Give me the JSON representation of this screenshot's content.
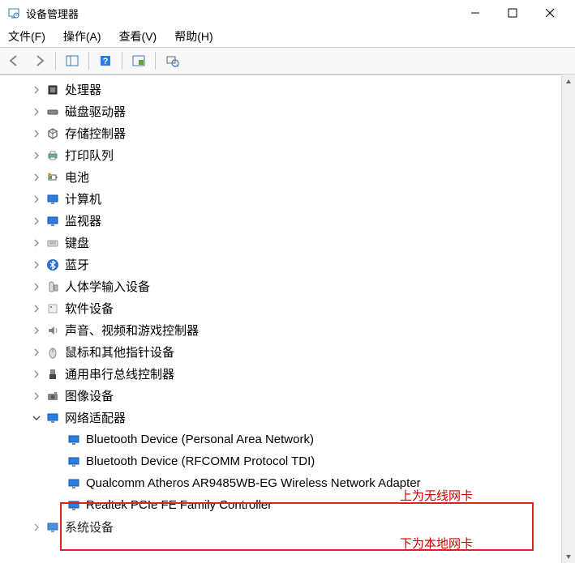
{
  "window": {
    "title": "设备管理器"
  },
  "menu": {
    "file": "文件(F)",
    "action": "操作(A)",
    "view": "查看(V)",
    "help": "帮助(H)"
  },
  "tree": {
    "items": [
      {
        "label": "处理器",
        "icon": "cpu",
        "expanded": false
      },
      {
        "label": "磁盘驱动器",
        "icon": "disk",
        "expanded": false
      },
      {
        "label": "存储控制器",
        "icon": "storage",
        "expanded": false
      },
      {
        "label": "打印队列",
        "icon": "printer",
        "expanded": false
      },
      {
        "label": "电池",
        "icon": "battery",
        "expanded": false
      },
      {
        "label": "计算机",
        "icon": "monitor",
        "expanded": false
      },
      {
        "label": "监视器",
        "icon": "monitor",
        "expanded": false
      },
      {
        "label": "键盘",
        "icon": "keyboard",
        "expanded": false
      },
      {
        "label": "蓝牙",
        "icon": "bluetooth",
        "expanded": false
      },
      {
        "label": "人体学输入设备",
        "icon": "hid",
        "expanded": false
      },
      {
        "label": "软件设备",
        "icon": "software",
        "expanded": false
      },
      {
        "label": "声音、视频和游戏控制器",
        "icon": "sound",
        "expanded": false
      },
      {
        "label": "鼠标和其他指针设备",
        "icon": "mouse",
        "expanded": false
      },
      {
        "label": "通用串行总线控制器",
        "icon": "usb",
        "expanded": false
      },
      {
        "label": "图像设备",
        "icon": "camera",
        "expanded": false
      },
      {
        "label": "网络适配器",
        "icon": "network",
        "expanded": true
      }
    ],
    "network_children": [
      {
        "label": "Bluetooth Device (Personal Area Network)"
      },
      {
        "label": "Bluetooth Device (RFCOMM Protocol TDI)"
      },
      {
        "label": "Qualcomm Atheros AR9485WB-EG Wireless Network Adapter"
      },
      {
        "label": "Realtek PCIe FE Family Controller"
      }
    ],
    "cutoff_label": "系统设备"
  },
  "annotations": {
    "top": "上为无线网卡",
    "bottom": "下为本地网卡"
  }
}
